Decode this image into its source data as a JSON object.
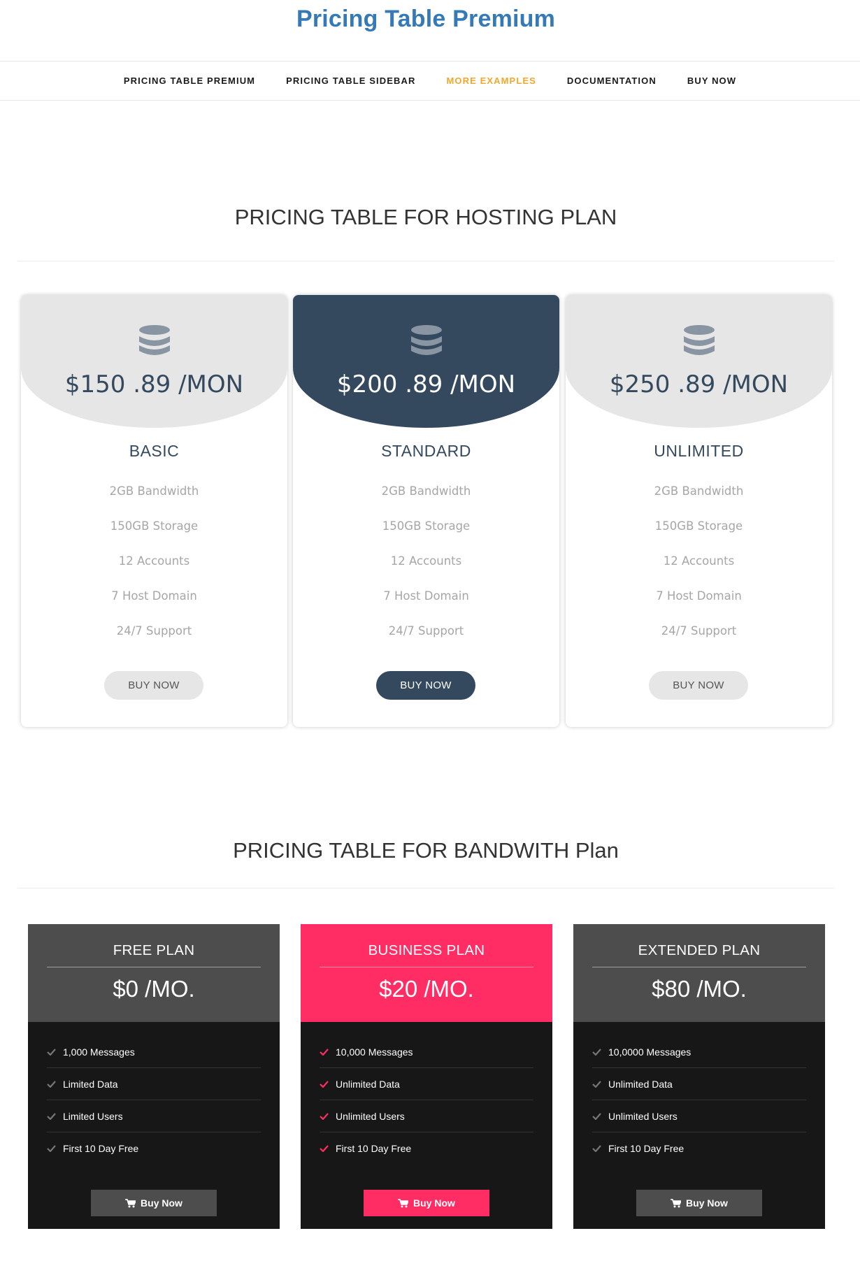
{
  "header": {
    "title": "Pricing Table Premium"
  },
  "nav": {
    "items": [
      {
        "label": "PRICING TABLE PREMIUM",
        "active": false
      },
      {
        "label": "PRICING TABLE SIDEBAR",
        "active": false
      },
      {
        "label": "MORE EXAMPLES",
        "active": true
      },
      {
        "label": "DOCUMENTATION",
        "active": false
      },
      {
        "label": "BUY NOW",
        "active": false
      }
    ]
  },
  "hosting": {
    "title": "PRICING TABLE FOR HOSTING PLAN",
    "plans": [
      {
        "price": "$150 .89 /MON",
        "name": "BASIC",
        "features": [
          "2GB Bandwidth",
          "150GB Storage",
          "12 Accounts",
          "7 Host Domain",
          "24/7 Support"
        ],
        "button": "BUY NOW",
        "icon": "database-icon"
      },
      {
        "price": "$200 .89 /MON",
        "name": "STANDARD",
        "features": [
          "2GB Bandwidth",
          "150GB Storage",
          "12 Accounts",
          "7 Host Domain",
          "24/7 Support"
        ],
        "button": "BUY NOW",
        "icon": "database-icon"
      },
      {
        "price": "$250 .89 /MON",
        "name": "UNLIMITED",
        "features": [
          "2GB Bandwidth",
          "150GB Storage",
          "12 Accounts",
          "7 Host Domain",
          "24/7 Support"
        ],
        "button": "BUY NOW",
        "icon": "database-icon"
      }
    ]
  },
  "bandwidth": {
    "title": "PRICING TABLE FOR BANDWITH Plan",
    "plans": [
      {
        "name": "FREE PLAN",
        "price": "$0 /MO.",
        "features": [
          "1,000 Messages",
          "Limited Data",
          "Limited Users",
          "First 10 Day Free"
        ],
        "button": "Buy Now",
        "icon": "cart-icon"
      },
      {
        "name": "BUSINESS PLAN",
        "price": "$20 /MO.",
        "features": [
          "10,000 Messages",
          "Unlimited Data",
          "Unlimited Users",
          "First 10 Day Free"
        ],
        "button": "Buy Now",
        "icon": "cart-icon"
      },
      {
        "name": "EXTENDED PLAN",
        "price": "$80 /MO.",
        "features": [
          "10,0000 Messages",
          "Unlimited Data",
          "Unlimited Users",
          "First 10 Day Free"
        ],
        "button": "Buy Now",
        "icon": "cart-icon"
      }
    ]
  },
  "colors": {
    "title_blue": "#3579b6",
    "nav_active": "#f4a62a",
    "hosting_featured": "#34495e",
    "hosting_light": "#e6e6e6",
    "bandwidth_featured": "#ff2d64",
    "bandwidth_head": "#4d4d4d",
    "bandwidth_body": "#171717"
  }
}
